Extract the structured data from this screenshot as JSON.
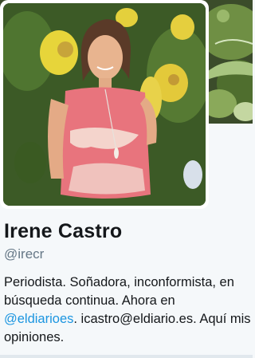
{
  "profile": {
    "name": "Irene Castro",
    "handle": "@irecr",
    "bio": {
      "text_before": "Periodista. Soñadora, inconformista, en búsqueda continua. Ahora en ",
      "mention": "@eldiarioes",
      "text_after": ". icastro@eldiario.es. Aquí mis opiniones."
    }
  },
  "theme": {
    "link_color": "#1b95e0",
    "name_color": "#14171a",
    "handle_color": "#657786",
    "card_background": "#f5f8fa"
  },
  "images": {
    "avatar_icon": "profile-photo",
    "banner_icon": "foliage-photo"
  }
}
